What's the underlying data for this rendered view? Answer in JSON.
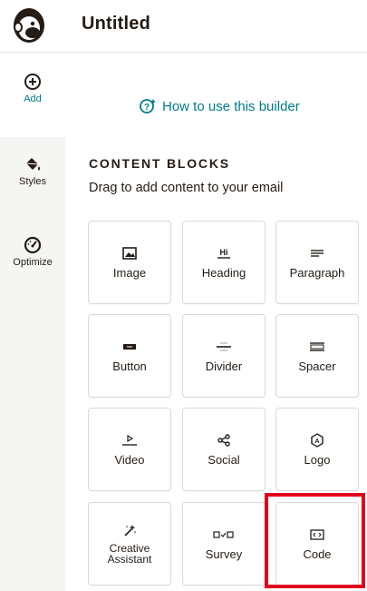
{
  "header": {
    "title": "Untitled",
    "logo_icon": "freddie-logo"
  },
  "rail": {
    "items": [
      {
        "label": "Add",
        "icon": "plus-circle-icon",
        "active": true
      },
      {
        "label": "Styles",
        "icon": "paint-bucket-icon",
        "active": false
      },
      {
        "label": "Optimize",
        "icon": "gauge-icon",
        "active": false
      }
    ]
  },
  "help_link": {
    "label": "How to use this builder",
    "icon": "sparkle-question-icon"
  },
  "content": {
    "heading": "CONTENT BLOCKS",
    "subheading": "Drag to add content to your email",
    "blocks": [
      {
        "label": "Image",
        "icon": "image-icon"
      },
      {
        "label": "Heading",
        "icon": "heading-icon",
        "glyph": "Hi"
      },
      {
        "label": "Paragraph",
        "icon": "paragraph-icon"
      },
      {
        "label": "Button",
        "icon": "button-icon"
      },
      {
        "label": "Divider",
        "icon": "divider-icon"
      },
      {
        "label": "Spacer",
        "icon": "spacer-icon"
      },
      {
        "label": "Video",
        "icon": "video-icon"
      },
      {
        "label": "Social",
        "icon": "share-icon"
      },
      {
        "label": "Logo",
        "icon": "logo-hexagon-icon",
        "glyph": "A"
      },
      {
        "label": "Creative Assistant",
        "icon": "magic-wand-icon"
      },
      {
        "label": "Survey",
        "icon": "survey-icon"
      },
      {
        "label": "Code",
        "icon": "code-icon"
      }
    ]
  },
  "colors": {
    "accent": "#007c89",
    "highlight": "#e0001b",
    "rail_bg": "#f5f5f3",
    "text": "#241c15"
  }
}
